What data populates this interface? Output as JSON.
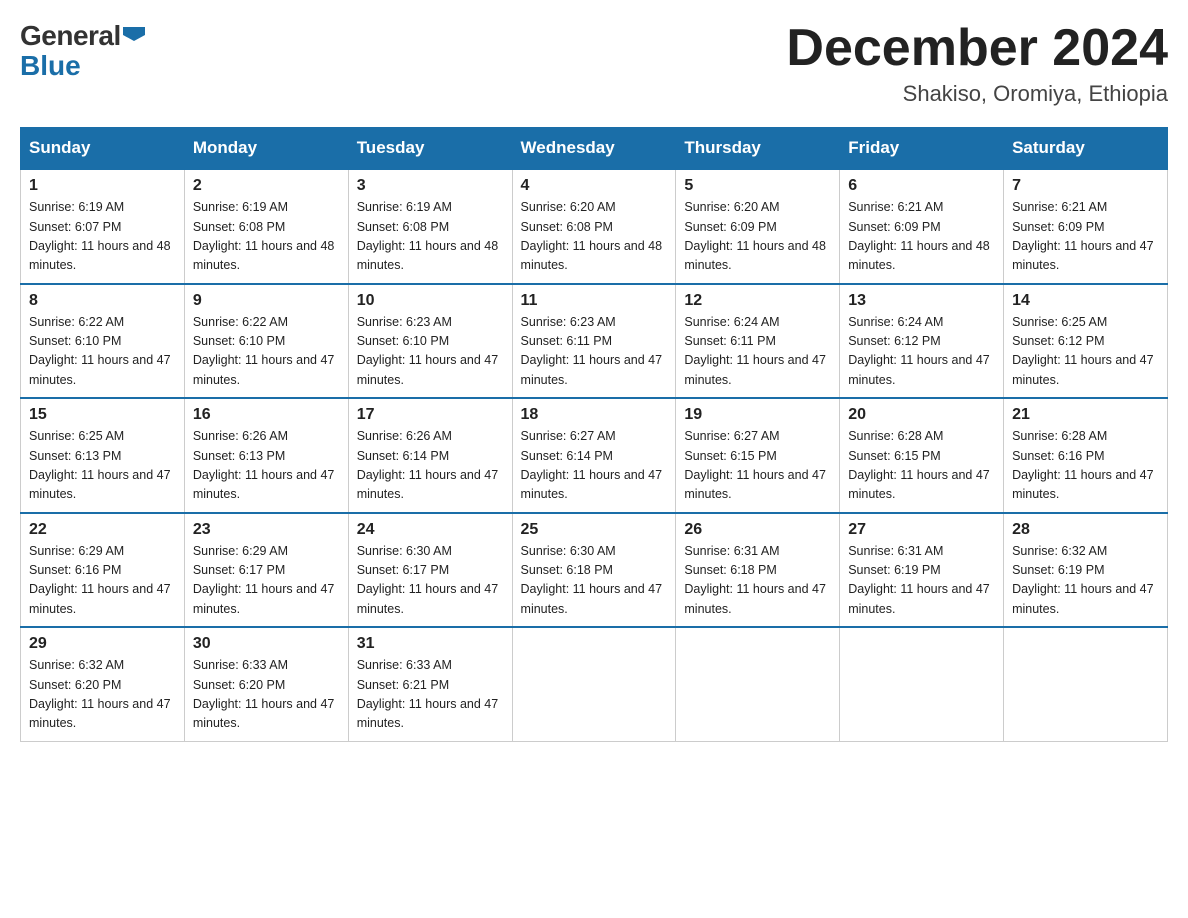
{
  "header": {
    "logo": {
      "general_text": "General",
      "blue_text": "Blue"
    },
    "title": "December 2024",
    "subtitle": "Shakiso, Oromiya, Ethiopia"
  },
  "days_of_week": [
    "Sunday",
    "Monday",
    "Tuesday",
    "Wednesday",
    "Thursday",
    "Friday",
    "Saturday"
  ],
  "weeks": [
    [
      {
        "day": "1",
        "sunrise": "6:19 AM",
        "sunset": "6:07 PM",
        "daylight": "11 hours and 48 minutes."
      },
      {
        "day": "2",
        "sunrise": "6:19 AM",
        "sunset": "6:08 PM",
        "daylight": "11 hours and 48 minutes."
      },
      {
        "day": "3",
        "sunrise": "6:19 AM",
        "sunset": "6:08 PM",
        "daylight": "11 hours and 48 minutes."
      },
      {
        "day": "4",
        "sunrise": "6:20 AM",
        "sunset": "6:08 PM",
        "daylight": "11 hours and 48 minutes."
      },
      {
        "day": "5",
        "sunrise": "6:20 AM",
        "sunset": "6:09 PM",
        "daylight": "11 hours and 48 minutes."
      },
      {
        "day": "6",
        "sunrise": "6:21 AM",
        "sunset": "6:09 PM",
        "daylight": "11 hours and 48 minutes."
      },
      {
        "day": "7",
        "sunrise": "6:21 AM",
        "sunset": "6:09 PM",
        "daylight": "11 hours and 47 minutes."
      }
    ],
    [
      {
        "day": "8",
        "sunrise": "6:22 AM",
        "sunset": "6:10 PM",
        "daylight": "11 hours and 47 minutes."
      },
      {
        "day": "9",
        "sunrise": "6:22 AM",
        "sunset": "6:10 PM",
        "daylight": "11 hours and 47 minutes."
      },
      {
        "day": "10",
        "sunrise": "6:23 AM",
        "sunset": "6:10 PM",
        "daylight": "11 hours and 47 minutes."
      },
      {
        "day": "11",
        "sunrise": "6:23 AM",
        "sunset": "6:11 PM",
        "daylight": "11 hours and 47 minutes."
      },
      {
        "day": "12",
        "sunrise": "6:24 AM",
        "sunset": "6:11 PM",
        "daylight": "11 hours and 47 minutes."
      },
      {
        "day": "13",
        "sunrise": "6:24 AM",
        "sunset": "6:12 PM",
        "daylight": "11 hours and 47 minutes."
      },
      {
        "day": "14",
        "sunrise": "6:25 AM",
        "sunset": "6:12 PM",
        "daylight": "11 hours and 47 minutes."
      }
    ],
    [
      {
        "day": "15",
        "sunrise": "6:25 AM",
        "sunset": "6:13 PM",
        "daylight": "11 hours and 47 minutes."
      },
      {
        "day": "16",
        "sunrise": "6:26 AM",
        "sunset": "6:13 PM",
        "daylight": "11 hours and 47 minutes."
      },
      {
        "day": "17",
        "sunrise": "6:26 AM",
        "sunset": "6:14 PM",
        "daylight": "11 hours and 47 minutes."
      },
      {
        "day": "18",
        "sunrise": "6:27 AM",
        "sunset": "6:14 PM",
        "daylight": "11 hours and 47 minutes."
      },
      {
        "day": "19",
        "sunrise": "6:27 AM",
        "sunset": "6:15 PM",
        "daylight": "11 hours and 47 minutes."
      },
      {
        "day": "20",
        "sunrise": "6:28 AM",
        "sunset": "6:15 PM",
        "daylight": "11 hours and 47 minutes."
      },
      {
        "day": "21",
        "sunrise": "6:28 AM",
        "sunset": "6:16 PM",
        "daylight": "11 hours and 47 minutes."
      }
    ],
    [
      {
        "day": "22",
        "sunrise": "6:29 AM",
        "sunset": "6:16 PM",
        "daylight": "11 hours and 47 minutes."
      },
      {
        "day": "23",
        "sunrise": "6:29 AM",
        "sunset": "6:17 PM",
        "daylight": "11 hours and 47 minutes."
      },
      {
        "day": "24",
        "sunrise": "6:30 AM",
        "sunset": "6:17 PM",
        "daylight": "11 hours and 47 minutes."
      },
      {
        "day": "25",
        "sunrise": "6:30 AM",
        "sunset": "6:18 PM",
        "daylight": "11 hours and 47 minutes."
      },
      {
        "day": "26",
        "sunrise": "6:31 AM",
        "sunset": "6:18 PM",
        "daylight": "11 hours and 47 minutes."
      },
      {
        "day": "27",
        "sunrise": "6:31 AM",
        "sunset": "6:19 PM",
        "daylight": "11 hours and 47 minutes."
      },
      {
        "day": "28",
        "sunrise": "6:32 AM",
        "sunset": "6:19 PM",
        "daylight": "11 hours and 47 minutes."
      }
    ],
    [
      {
        "day": "29",
        "sunrise": "6:32 AM",
        "sunset": "6:20 PM",
        "daylight": "11 hours and 47 minutes."
      },
      {
        "day": "30",
        "sunrise": "6:33 AM",
        "sunset": "6:20 PM",
        "daylight": "11 hours and 47 minutes."
      },
      {
        "day": "31",
        "sunrise": "6:33 AM",
        "sunset": "6:21 PM",
        "daylight": "11 hours and 47 minutes."
      },
      null,
      null,
      null,
      null
    ]
  ],
  "labels": {
    "sunrise_prefix": "Sunrise: ",
    "sunset_prefix": "Sunset: ",
    "daylight_prefix": "Daylight: "
  }
}
